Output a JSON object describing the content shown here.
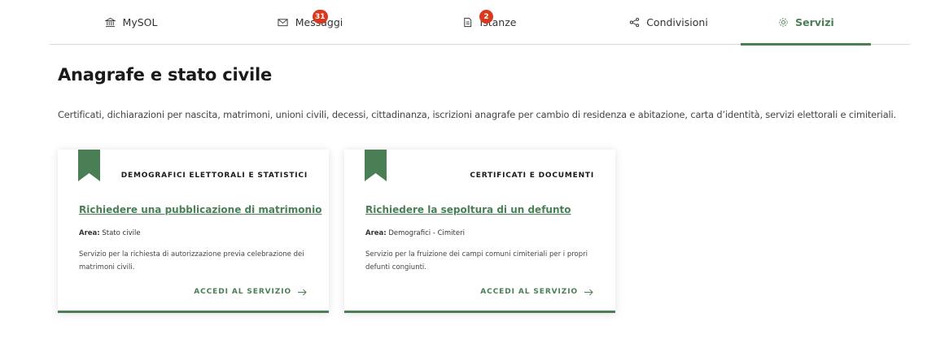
{
  "nav": {
    "tabs": [
      {
        "label": "MySOL",
        "icon": "bank-icon",
        "badge": ""
      },
      {
        "label": "Messaggi",
        "icon": "envelope-icon",
        "badge": "31"
      },
      {
        "label": "Istanze",
        "icon": "document-icon",
        "badge": "2"
      },
      {
        "label": "Condivisioni",
        "icon": "share-icon",
        "badge": ""
      },
      {
        "label": "Servizi",
        "icon": "gear-icon",
        "badge": ""
      }
    ],
    "active": "Servizi"
  },
  "page": {
    "title": "Anagrafe e stato civile",
    "description": "Certificati, dichiarazioni per nascita, matrimoni, unioni civili, decessi, cittadinanza, iscrizioni anagrafe per cambio di residenza e abitazione, carta d’identità, servizi elettorali e cimiteriali."
  },
  "cards": [
    {
      "category": "Demografici elettorali e statistici",
      "title": "Richiedere una pubblicazione di matrimonio",
      "area_label": "Area:",
      "area_value": "Stato civile",
      "description": "Servizio per la richiesta di autorizzazione previa celebrazione dei matrimoni civili.",
      "cta": "Accedi al servizio"
    },
    {
      "category": "Certificati e documenti",
      "title": "Richiedere la sepoltura di un defunto",
      "area_label": "Area:",
      "area_value": "Demografici - Cimiteri",
      "description": "Servizio per la fruizione dei campi comuni cimiteriali per i propri defunti congiunti.",
      "cta": "Accedi al servizio"
    }
  ],
  "colors": {
    "accent": "#4a7f56",
    "badge": "#d9391f"
  }
}
